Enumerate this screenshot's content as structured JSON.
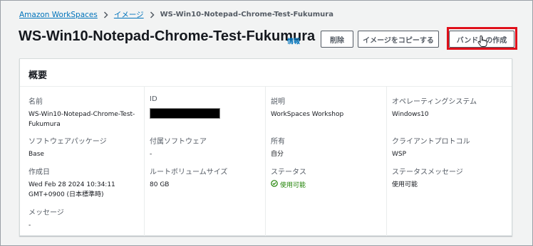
{
  "breadcrumb": {
    "root": "Amazon WorkSpaces",
    "images": "イメージ",
    "current": "WS-Win10-Notepad-Chrome-Test-Fukumura"
  },
  "header": {
    "title": "WS-Win10-Notepad-Chrome-Test-Fukumura",
    "info": "情報",
    "delete_label": "削除",
    "copy_label": "イメージをコピーする",
    "create_bundle_label": "バンドルの作成"
  },
  "summary": {
    "title": "概要",
    "name_label": "名前",
    "name_value_1": "WS-Win10-Notepad-Chrome-Test-",
    "name_value_2": "Fukumura",
    "software_package_label": "ソフトウェアパッケージ",
    "software_package_value": "Base",
    "created_label": "作成日",
    "created_value_1": "Wed Feb 28 2024 10:34:11",
    "created_value_2": "GMT+0900 (日本標準時)",
    "message_label": "メッセージ",
    "message_value": "-",
    "id_label": "ID",
    "attached_software_label": "付属ソフトウェア",
    "attached_software_value": "-",
    "root_volume_label": "ルートボリュームサイズ",
    "root_volume_value": "80 GB",
    "description_label": "説明",
    "description_value": "WorkSpaces Workshop",
    "owner_label": "所有",
    "owner_value": "自分",
    "status_label": "ステータス",
    "status_value": "使用可能",
    "os_label": "オペレーティングシステム",
    "os_value": "Windows10",
    "client_protocol_label": "クライアントプロトコル",
    "client_protocol_value": "WSP",
    "status_message_label": "ステータスメッセージ",
    "status_message_value": "使用可能"
  },
  "colors": {
    "link": "#0073bb",
    "success": "#1d8102",
    "highlight": "#e0101a"
  }
}
